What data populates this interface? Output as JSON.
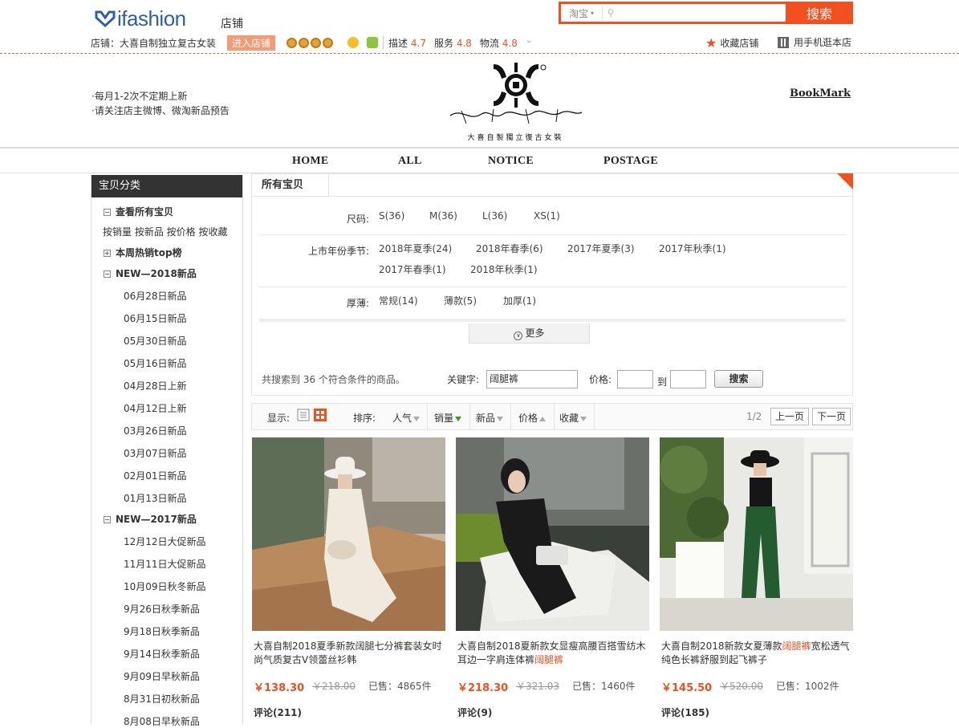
{
  "header": {
    "logo_text": "ifashion",
    "logo_sub": "店铺",
    "search_scope": "淘宝",
    "search_button": "搜索",
    "shop_label": "店铺：",
    "shop_name": "大喜自制独立复古女装",
    "enter_shop": "进入店铺",
    "scores": [
      {
        "label": "描述",
        "value": "4.7"
      },
      {
        "label": "服务",
        "value": "4.8"
      },
      {
        "label": "物流",
        "value": "4.8"
      }
    ],
    "collect_shop": "收藏店铺",
    "mobile_shop": "用手机逛本店"
  },
  "banner": {
    "note1": "·每月1-2次不定期上新",
    "note2": "·请关注店主微博、微淘新品预告",
    "brand_caption": "大喜自製獨立復古女裝",
    "bookmark": "BookMark"
  },
  "nav": [
    "HOME",
    "ALL",
    "NOTICE",
    "POSTAGE"
  ],
  "sidebar": {
    "title": "宝贝分类",
    "view_all": "查看所有宝贝",
    "sort_links": "按销量 按新品 按价格 按收藏",
    "top_week": "本周热销top榜",
    "group2018": "NEW—2018新品",
    "items2018": [
      "06月28日新品",
      "06月15日新品",
      "05月30日新品",
      "05月16日新品",
      "04月28日上新",
      "04月12日上新",
      "03月26日新品",
      "03月07日新品",
      "02月01日新品",
      "01月13日新品"
    ],
    "group2017": "NEW—2017新品",
    "items2017": [
      "12月12日大促新品",
      "11月11日大促新品",
      "10月09日秋冬新品",
      "9月26日秋季新品",
      "9月18日秋季新品",
      "9月14日秋季新品",
      "9月09日早秋新品",
      "8月31日初秋新品",
      "8月08日早秋新品"
    ]
  },
  "filter": {
    "tab": "所有宝贝",
    "size_label": "尺码:",
    "sizes": [
      "S(36)",
      "M(36)",
      "L(36)",
      "XS(1)"
    ],
    "season_label": "上市年份季节:",
    "seasons": [
      "2018年夏季(24)",
      "2018年春季(6)",
      "2017年夏季(3)",
      "2017年秋季(1)",
      "2017年春季(1)",
      "2018年秋季(1)"
    ],
    "thick_label": "厚薄:",
    "thickness": [
      "常规(14)",
      "薄款(5)",
      "加厚(1)"
    ],
    "more": "更多",
    "result": "共搜索到 36 个符合条件的商品。",
    "keyword_label": "关键字:",
    "keyword_value": "阔腿裤",
    "price_label": "价格:",
    "to": "到",
    "search_btn": "搜索"
  },
  "sortbar": {
    "display": "显示:",
    "sort": "排序:",
    "options": [
      "人气",
      "销量",
      "新品",
      "价格",
      "收藏"
    ],
    "page": "1/2",
    "prev": "上一页",
    "next": "下一页"
  },
  "products": [
    {
      "title_a": "大喜自制2018夏季新款阔腿七分裤套装女时尚气质复古V领蕾丝衫韩",
      "title_hl": "",
      "title_b": "",
      "price": "￥138.30",
      "old": "￥218.00",
      "sold": "已售：4865件",
      "reviews": "评论(211)"
    },
    {
      "title_a": "大喜自制2018夏新款女显瘦高腰百搭雪纺木耳边一字肩连体裤",
      "title_hl": "阔腿裤",
      "title_b": "",
      "price": "￥218.30",
      "old": "￥321.03",
      "sold": "已售：1460件",
      "reviews": "评论(9)"
    },
    {
      "title_a": "大喜自制2018新款女夏薄款",
      "title_hl": "阔腿裤",
      "title_b": "宽松透气纯色长裤舒服到起飞裤子",
      "price": "￥145.50",
      "old": "￥520.00",
      "sold": "已售：1002件",
      "reviews": "评论(185)"
    }
  ],
  "colors": {
    "accent": "#f2501e",
    "logo": "#2e5fa8",
    "sidebar_head": "#333333"
  }
}
